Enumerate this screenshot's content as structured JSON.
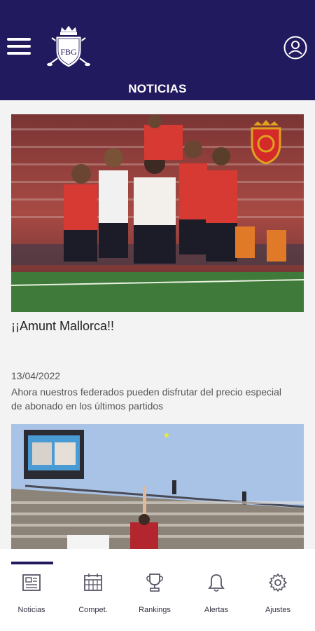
{
  "header": {
    "title": "NOTICIAS",
    "logo_letters": "FBG",
    "menu_icon": "menu-icon",
    "profile_icon": "user-circle-icon"
  },
  "news": [
    {
      "title": "¡¡Amunt Mallorca!!",
      "date": "13/04/2022",
      "summary": "Ahora nuestros federados pueden disfrutar del precio especial de abonado en los últimos partidos",
      "image": "football-team-celebration-photo"
    },
    {
      "image": "tennis-stadium-crowd-photo"
    }
  ],
  "tabs": [
    {
      "label": "Noticias",
      "icon": "newspaper-icon",
      "active": true
    },
    {
      "label": "Compet.",
      "icon": "calendar-grid-icon",
      "active": false
    },
    {
      "label": "Rankings",
      "icon": "trophy-icon",
      "active": false
    },
    {
      "label": "Alertas",
      "icon": "bell-icon",
      "active": false
    },
    {
      "label": "Ajustes",
      "icon": "gear-icon",
      "active": false
    }
  ],
  "colors": {
    "header_bg": "#221a5e",
    "feed_bg": "#f3f3f3",
    "accent": "#221a5e"
  }
}
